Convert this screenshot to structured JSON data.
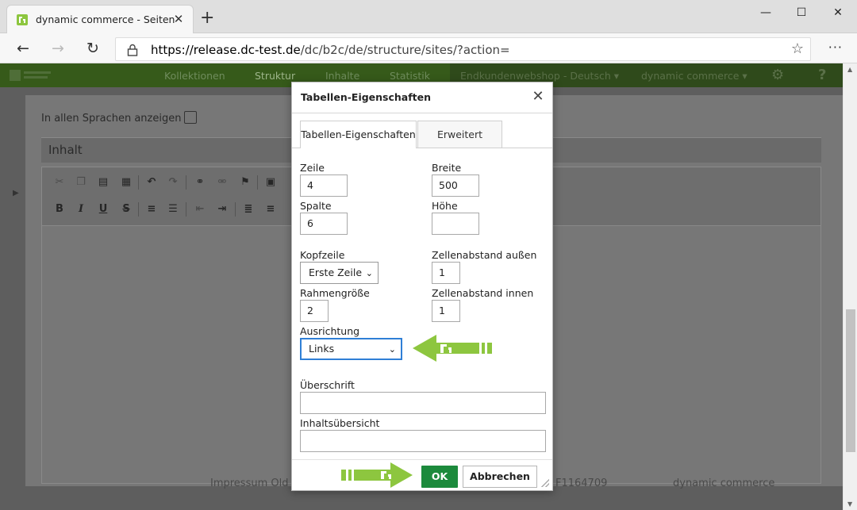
{
  "browser": {
    "tab_title": "dynamic commerce - Seiten",
    "url_host": "https://release.dc-test.de",
    "url_path": "/dc/b2c/de/structure/sites/?action="
  },
  "app": {
    "nav": [
      "Kollektionen",
      "Struktur",
      "Inhalte",
      "Statistik"
    ],
    "shop_select": "Endkundenwebshop - Deutsch",
    "company_select": "dynamic commerce"
  },
  "page": {
    "lang_label": "In allen Sprachen anzeigen",
    "content_heading": "Inhalt",
    "footer_left": "Impressum Old",
    "footer_mid": "F1164709",
    "footer_right": "dynamic commerce"
  },
  "dialog": {
    "title": "Tabellen-Eigenschaften",
    "tabs": [
      "Tabellen-Eigenschaften",
      "Erweitert"
    ],
    "rows_label": "Zeile",
    "rows_value": "4",
    "cols_label": "Spalte",
    "cols_value": "6",
    "width_label": "Breite",
    "width_value": "500",
    "height_label": "Höhe",
    "height_value": "",
    "header_label": "Kopfzeile",
    "header_value": "Erste Zeile",
    "cellspacing_label": "Zellenabstand außen",
    "cellspacing_value": "1",
    "border_label": "Rahmengröße",
    "border_value": "2",
    "cellpadding_label": "Zellenabstand innen",
    "cellpadding_value": "1",
    "align_label": "Ausrichtung",
    "align_value": "Links",
    "caption_label": "Überschrift",
    "caption_value": "",
    "summary_label": "Inhaltsübersicht",
    "summary_value": "",
    "ok_label": "OK",
    "cancel_label": "Abbrechen"
  },
  "colors": {
    "brand_green": "#8dc63f",
    "ok_green": "#1c8a3c",
    "focus_blue": "#2f7fd6"
  }
}
